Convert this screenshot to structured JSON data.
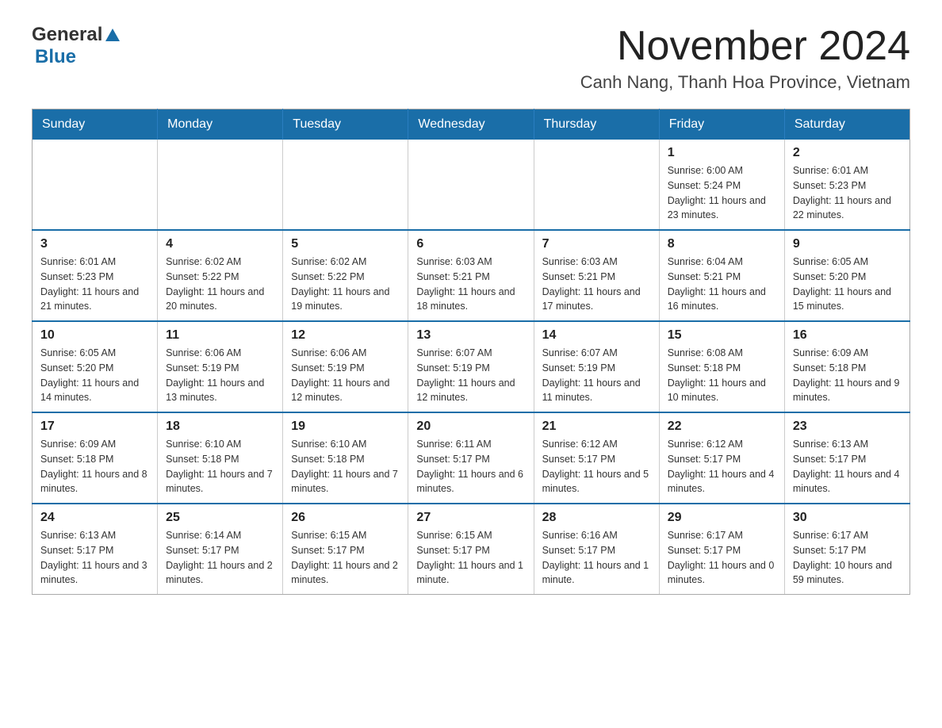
{
  "header": {
    "logo_general": "General",
    "logo_blue": "Blue",
    "title": "November 2024",
    "subtitle": "Canh Nang, Thanh Hoa Province, Vietnam"
  },
  "calendar": {
    "days_of_week": [
      "Sunday",
      "Monday",
      "Tuesday",
      "Wednesday",
      "Thursday",
      "Friday",
      "Saturday"
    ],
    "weeks": [
      [
        {
          "day": "",
          "info": ""
        },
        {
          "day": "",
          "info": ""
        },
        {
          "day": "",
          "info": ""
        },
        {
          "day": "",
          "info": ""
        },
        {
          "day": "",
          "info": ""
        },
        {
          "day": "1",
          "info": "Sunrise: 6:00 AM\nSunset: 5:24 PM\nDaylight: 11 hours and 23 minutes."
        },
        {
          "day": "2",
          "info": "Sunrise: 6:01 AM\nSunset: 5:23 PM\nDaylight: 11 hours and 22 minutes."
        }
      ],
      [
        {
          "day": "3",
          "info": "Sunrise: 6:01 AM\nSunset: 5:23 PM\nDaylight: 11 hours and 21 minutes."
        },
        {
          "day": "4",
          "info": "Sunrise: 6:02 AM\nSunset: 5:22 PM\nDaylight: 11 hours and 20 minutes."
        },
        {
          "day": "5",
          "info": "Sunrise: 6:02 AM\nSunset: 5:22 PM\nDaylight: 11 hours and 19 minutes."
        },
        {
          "day": "6",
          "info": "Sunrise: 6:03 AM\nSunset: 5:21 PM\nDaylight: 11 hours and 18 minutes."
        },
        {
          "day": "7",
          "info": "Sunrise: 6:03 AM\nSunset: 5:21 PM\nDaylight: 11 hours and 17 minutes."
        },
        {
          "day": "8",
          "info": "Sunrise: 6:04 AM\nSunset: 5:21 PM\nDaylight: 11 hours and 16 minutes."
        },
        {
          "day": "9",
          "info": "Sunrise: 6:05 AM\nSunset: 5:20 PM\nDaylight: 11 hours and 15 minutes."
        }
      ],
      [
        {
          "day": "10",
          "info": "Sunrise: 6:05 AM\nSunset: 5:20 PM\nDaylight: 11 hours and 14 minutes."
        },
        {
          "day": "11",
          "info": "Sunrise: 6:06 AM\nSunset: 5:19 PM\nDaylight: 11 hours and 13 minutes."
        },
        {
          "day": "12",
          "info": "Sunrise: 6:06 AM\nSunset: 5:19 PM\nDaylight: 11 hours and 12 minutes."
        },
        {
          "day": "13",
          "info": "Sunrise: 6:07 AM\nSunset: 5:19 PM\nDaylight: 11 hours and 12 minutes."
        },
        {
          "day": "14",
          "info": "Sunrise: 6:07 AM\nSunset: 5:19 PM\nDaylight: 11 hours and 11 minutes."
        },
        {
          "day": "15",
          "info": "Sunrise: 6:08 AM\nSunset: 5:18 PM\nDaylight: 11 hours and 10 minutes."
        },
        {
          "day": "16",
          "info": "Sunrise: 6:09 AM\nSunset: 5:18 PM\nDaylight: 11 hours and 9 minutes."
        }
      ],
      [
        {
          "day": "17",
          "info": "Sunrise: 6:09 AM\nSunset: 5:18 PM\nDaylight: 11 hours and 8 minutes."
        },
        {
          "day": "18",
          "info": "Sunrise: 6:10 AM\nSunset: 5:18 PM\nDaylight: 11 hours and 7 minutes."
        },
        {
          "day": "19",
          "info": "Sunrise: 6:10 AM\nSunset: 5:18 PM\nDaylight: 11 hours and 7 minutes."
        },
        {
          "day": "20",
          "info": "Sunrise: 6:11 AM\nSunset: 5:17 PM\nDaylight: 11 hours and 6 minutes."
        },
        {
          "day": "21",
          "info": "Sunrise: 6:12 AM\nSunset: 5:17 PM\nDaylight: 11 hours and 5 minutes."
        },
        {
          "day": "22",
          "info": "Sunrise: 6:12 AM\nSunset: 5:17 PM\nDaylight: 11 hours and 4 minutes."
        },
        {
          "day": "23",
          "info": "Sunrise: 6:13 AM\nSunset: 5:17 PM\nDaylight: 11 hours and 4 minutes."
        }
      ],
      [
        {
          "day": "24",
          "info": "Sunrise: 6:13 AM\nSunset: 5:17 PM\nDaylight: 11 hours and 3 minutes."
        },
        {
          "day": "25",
          "info": "Sunrise: 6:14 AM\nSunset: 5:17 PM\nDaylight: 11 hours and 2 minutes."
        },
        {
          "day": "26",
          "info": "Sunrise: 6:15 AM\nSunset: 5:17 PM\nDaylight: 11 hours and 2 minutes."
        },
        {
          "day": "27",
          "info": "Sunrise: 6:15 AM\nSunset: 5:17 PM\nDaylight: 11 hours and 1 minute."
        },
        {
          "day": "28",
          "info": "Sunrise: 6:16 AM\nSunset: 5:17 PM\nDaylight: 11 hours and 1 minute."
        },
        {
          "day": "29",
          "info": "Sunrise: 6:17 AM\nSunset: 5:17 PM\nDaylight: 11 hours and 0 minutes."
        },
        {
          "day": "30",
          "info": "Sunrise: 6:17 AM\nSunset: 5:17 PM\nDaylight: 10 hours and 59 minutes."
        }
      ]
    ]
  }
}
